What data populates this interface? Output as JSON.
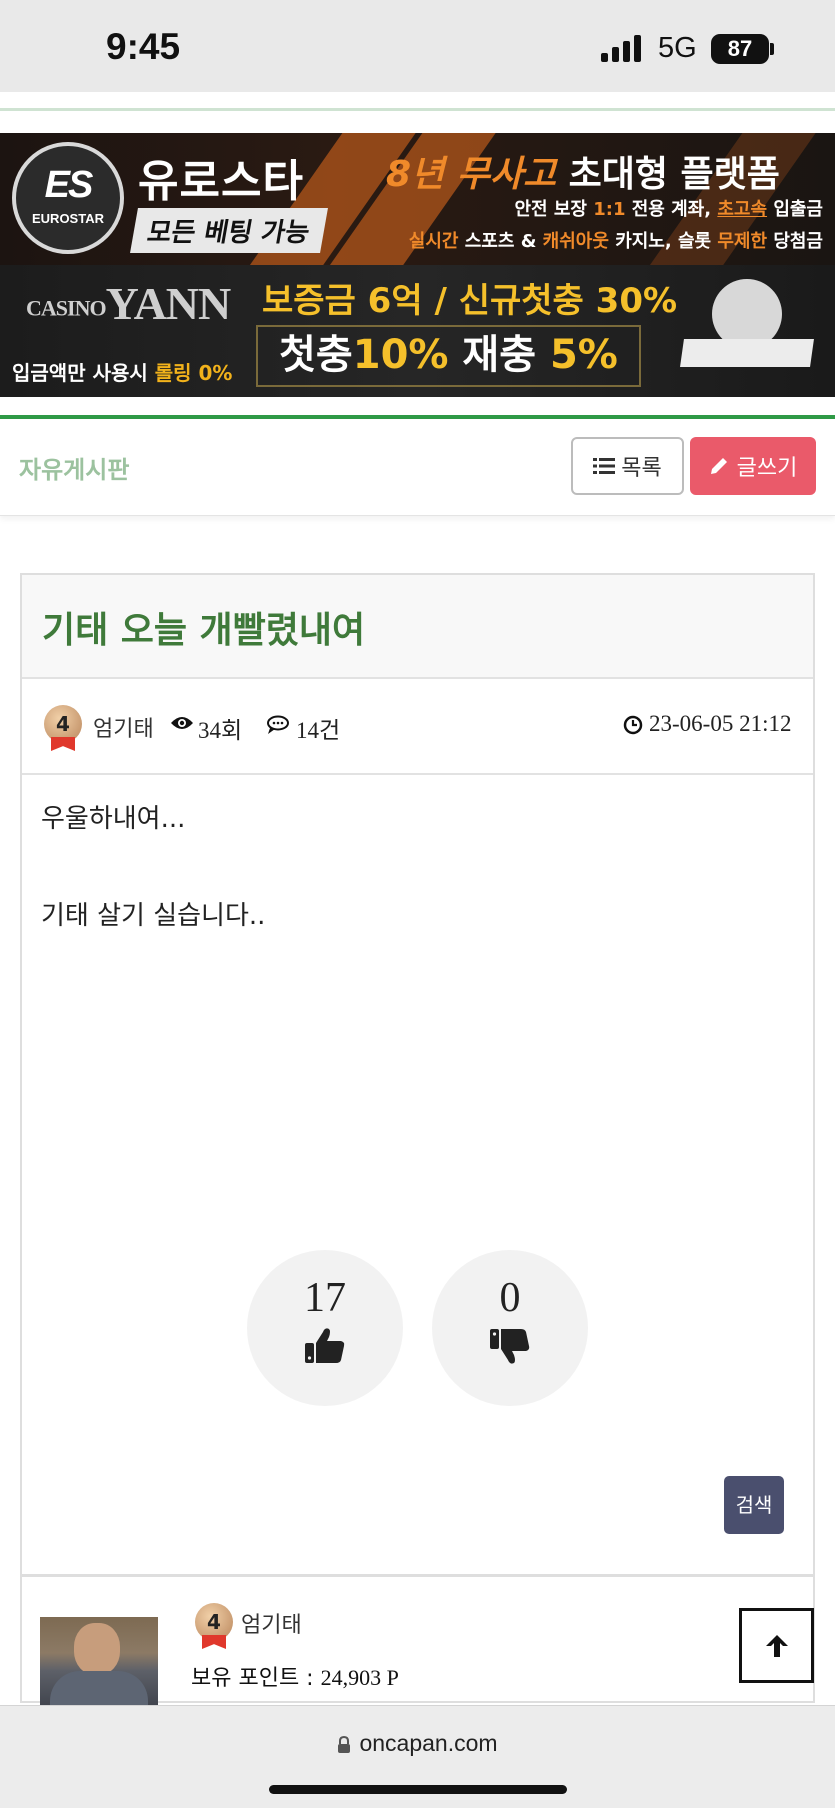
{
  "status_bar": {
    "time": "9:45",
    "network": "5G",
    "battery": "87"
  },
  "ads": {
    "banner1": {
      "logo_mark": "ES",
      "logo_text": "EUROSTAR",
      "brand": "유로스타",
      "sub": "모든 베팅 가능",
      "headline_a": "8년 무사고",
      "headline_b": "초대형 플랫폼",
      "line2_a": "안전 보장 ",
      "line2_b": "1:1",
      "line2_c": " 전용 계좌, ",
      "line2_d": "초고속",
      "line2_e": " 입출금",
      "line3_a": "실시간",
      "line3_b": " 스포츠 & ",
      "line3_c": "캐쉬아웃",
      "line3_d": " 카지노, 슬롯 ",
      "line3_e": "무제한",
      "line3_f": " 당첨금"
    },
    "banner2": {
      "logo_small": "CASINO",
      "logo_text": "YANN",
      "left_a": "입금액만 사용시 ",
      "left_b": "롤링 0%",
      "line1": "보증금 6억 / 신규첫충 30%",
      "box_a": "첫충",
      "box_b": "10%",
      "box_c": " 재충 ",
      "box_d": "5%"
    }
  },
  "board": {
    "title": "자유게시판",
    "list_button": "목록",
    "write_button": "글쓰기"
  },
  "post": {
    "title": "기태 오늘 개빨렸내여",
    "author": "엄기태",
    "author_level": "4",
    "views": "34회",
    "comments": "14건",
    "date": "23-06-05 21:12",
    "body": [
      "우울하내여...",
      "기태 살기 실습니다.."
    ],
    "likes": "17",
    "dislikes": "0",
    "search_button": "검색"
  },
  "author_box": {
    "name": "엄기태",
    "level": "4",
    "points_label": "보유 포인트 : ",
    "points_value": "24,903 P"
  },
  "browser": {
    "url": "oncapan.com"
  },
  "icons": {
    "list": "list-icon",
    "write": "pencil-icon",
    "views": "eye-icon",
    "comments": "comment-icon",
    "date": "clock-icon",
    "like": "thumbs-up-icon",
    "dislike": "thumbs-down-icon",
    "top": "arrow-up-icon",
    "lock": "lock-icon"
  },
  "colors": {
    "accent_green": "#3f7a3a",
    "board_title": "#9cc29f",
    "write_button": "#ea5a6a",
    "search_button": "#4a4f6e",
    "top_line": "#2f9a46"
  }
}
